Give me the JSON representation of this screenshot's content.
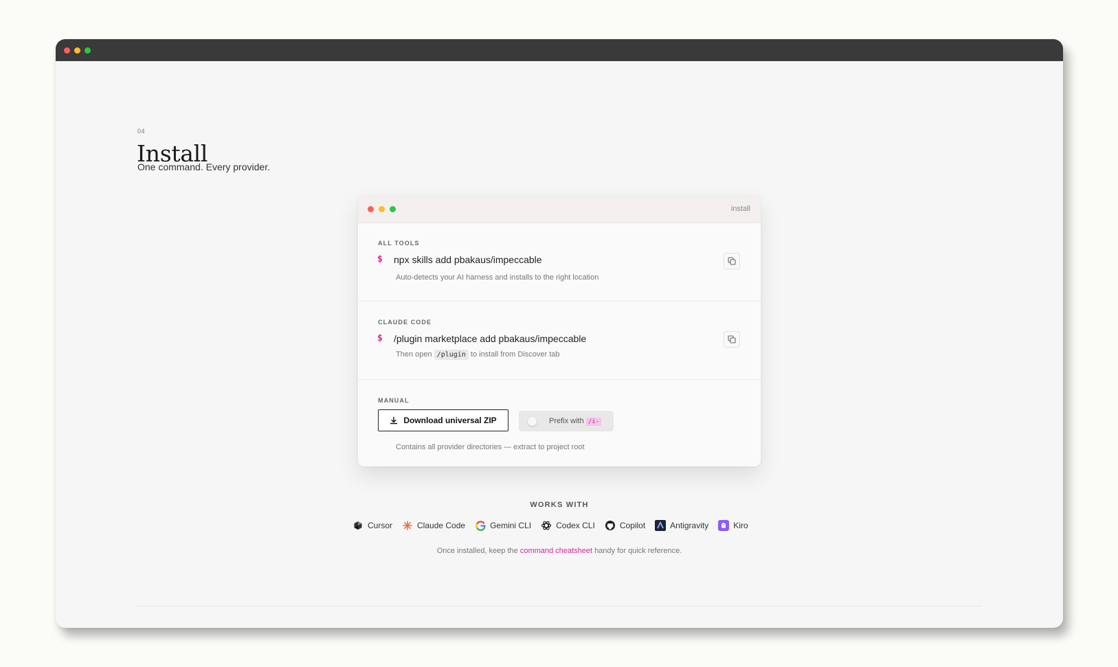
{
  "section": {
    "number": "04",
    "title": "Install",
    "subtitle": "One command. Every provider."
  },
  "terminal": {
    "label": "install",
    "all_tools": {
      "caption": "ALL TOOLS",
      "prompt": "$",
      "command": "npx skills add pbakaus/impeccable",
      "note": "Auto-detects your AI harness and installs to the right location"
    },
    "claude_code": {
      "caption": "CLAUDE CODE",
      "prompt": "$",
      "command": "/plugin marketplace add pbakaus/impeccable",
      "note_before": "Then open",
      "note_code": "/plugin",
      "note_after": "to install from Discover tab"
    },
    "manual": {
      "caption": "MANUAL",
      "download_label": "Download universal ZIP",
      "prefix_label": "Prefix with",
      "prefix_chip": "/i-",
      "prefix_enabled": false,
      "note": "Contains all provider directories — extract to project root"
    }
  },
  "works_with": {
    "heading": "WORKS WITH",
    "providers": [
      {
        "name": "Cursor",
        "icon": "cursor-icon"
      },
      {
        "name": "Claude Code",
        "icon": "claude-icon"
      },
      {
        "name": "Gemini CLI",
        "icon": "google-icon"
      },
      {
        "name": "Codex CLI",
        "icon": "openai-icon"
      },
      {
        "name": "Copilot",
        "icon": "github-icon"
      },
      {
        "name": "Antigravity",
        "icon": "antigravity-icon"
      },
      {
        "name": "Kiro",
        "icon": "kiro-icon"
      }
    ]
  },
  "footer": {
    "before": "Once installed, keep the",
    "link": "command cheatsheet",
    "after": "handy for quick reference."
  },
  "colors": {
    "accent": "#d6249f",
    "window_bar": "#3a3a3a",
    "dot_red": "#ff5f57",
    "dot_yellow": "#febc2e",
    "dot_green": "#28c840"
  }
}
